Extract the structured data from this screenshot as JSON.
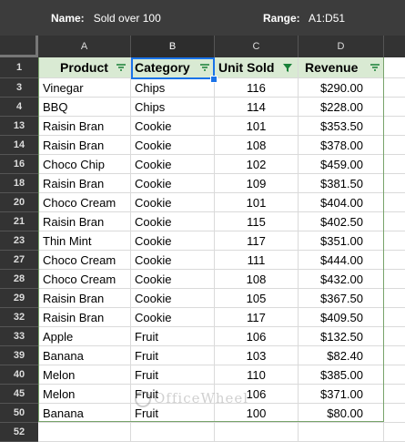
{
  "filter_view": {
    "name_label": "Name:",
    "name_value": "Sold over 100",
    "range_label": "Range:",
    "range_value": "A1:D51"
  },
  "columns": [
    "A",
    "B",
    "C",
    "D"
  ],
  "header_row": {
    "row_number": "1",
    "cells": [
      "Product",
      "Category",
      "Unit Sold",
      "Revenue"
    ],
    "filter_active_column": "Unit Sold"
  },
  "rows": [
    {
      "n": "3",
      "product": "Vinegar",
      "category": "Chips",
      "units": "116",
      "revenue": "$290.00"
    },
    {
      "n": "4",
      "product": "BBQ",
      "category": "Chips",
      "units": "114",
      "revenue": "$228.00"
    },
    {
      "n": "13",
      "product": "Raisin Bran",
      "category": "Cookie",
      "units": "101",
      "revenue": "$353.50"
    },
    {
      "n": "14",
      "product": "Raisin Bran",
      "category": "Cookie",
      "units": "108",
      "revenue": "$378.00"
    },
    {
      "n": "16",
      "product": "Choco Chip",
      "category": "Cookie",
      "units": "102",
      "revenue": "$459.00"
    },
    {
      "n": "18",
      "product": "Raisin Bran",
      "category": "Cookie",
      "units": "109",
      "revenue": "$381.50"
    },
    {
      "n": "20",
      "product": "Choco Cream",
      "category": "Cookie",
      "units": "101",
      "revenue": "$404.00"
    },
    {
      "n": "21",
      "product": "Raisin Bran",
      "category": "Cookie",
      "units": "115",
      "revenue": "$402.50"
    },
    {
      "n": "23",
      "product": "Thin Mint",
      "category": "Cookie",
      "units": "117",
      "revenue": "$351.00"
    },
    {
      "n": "27",
      "product": "Choco Cream",
      "category": "Cookie",
      "units": "111",
      "revenue": "$444.00"
    },
    {
      "n": "28",
      "product": "Choco Cream",
      "category": "Cookie",
      "units": "108",
      "revenue": "$432.00"
    },
    {
      "n": "29",
      "product": "Raisin Bran",
      "category": "Cookie",
      "units": "105",
      "revenue": "$367.50"
    },
    {
      "n": "32",
      "product": "Raisin Bran",
      "category": "Cookie",
      "units": "117",
      "revenue": "$409.50"
    },
    {
      "n": "33",
      "product": "Apple",
      "category": "Fruit",
      "units": "106",
      "revenue": "$132.50"
    },
    {
      "n": "39",
      "product": "Banana",
      "category": "Fruit",
      "units": "103",
      "revenue": "$82.40"
    },
    {
      "n": "40",
      "product": "Melon",
      "category": "Fruit",
      "units": "110",
      "revenue": "$385.00"
    },
    {
      "n": "45",
      "product": "Melon",
      "category": "Fruit",
      "units": "106",
      "revenue": "$371.00"
    },
    {
      "n": "50",
      "product": "Banana",
      "category": "Fruit",
      "units": "100",
      "revenue": "$80.00"
    }
  ],
  "empty_row_number": "52",
  "watermark": "OfficeWheel",
  "colors": {
    "header_fill": "#d9ead3",
    "filter_icon": "#188038",
    "selection": "#1a73e8"
  }
}
